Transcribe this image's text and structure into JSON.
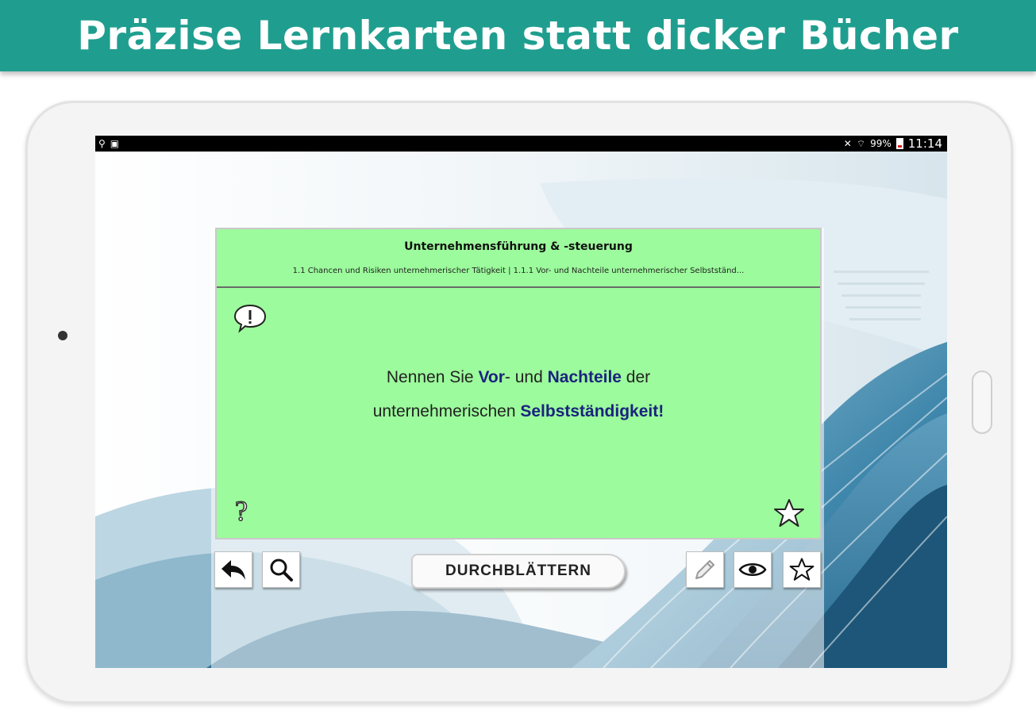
{
  "banner": {
    "title": "Präzise Lernkarten statt dicker Bücher"
  },
  "statusbar": {
    "battery": "99%",
    "time": "11:14"
  },
  "card": {
    "title": "Unternehmensführung & -steuerung",
    "subtitle": "1.1 Chancen und Risiken unternehmerischer Tätigkeit | 1.1.1 Vor- und Nachteile unternehmerischer Selbstständ...",
    "question": {
      "line1_a": "Nennen Sie ",
      "line1_kw1": "Vor",
      "line1_b": "- und ",
      "line1_kw2": "Nachteile",
      "line1_c": " der",
      "line2_a": "unternehmerischen ",
      "line2_kw": "Selbstständigkeit!"
    },
    "color": "#9cfb9c",
    "keyword_color": "#1a237e"
  },
  "toolbar": {
    "browse_label": "DURCHBLÄTTERN",
    "icons": [
      "back-arrow-icon",
      "search-icon",
      "pencil-icon",
      "eye-icon",
      "star-icon"
    ]
  },
  "colors": {
    "banner": "#1f9e8f"
  }
}
